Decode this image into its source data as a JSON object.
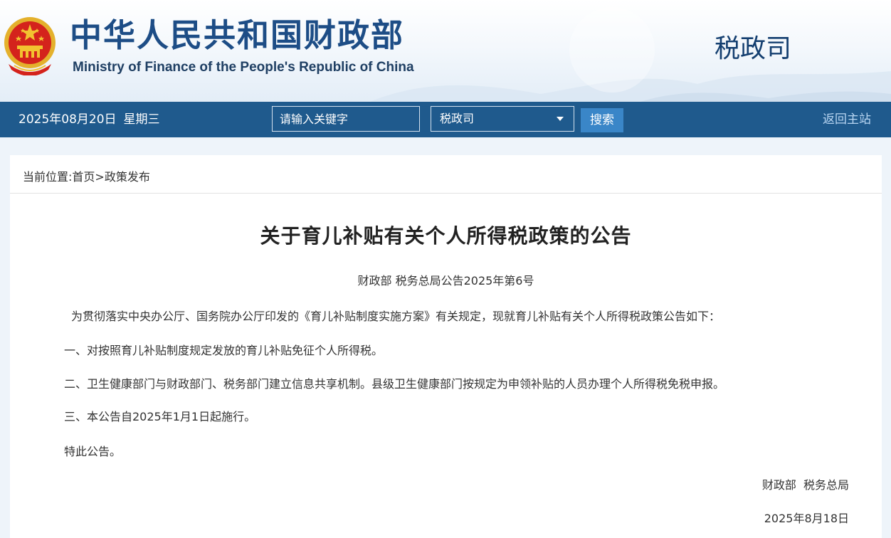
{
  "header": {
    "site_title": "中华人民共和国财政部",
    "site_subtitle": "Ministry of Finance of the People's Republic of China",
    "department": "税政司",
    "emblem_icon": "national-emblem-icon"
  },
  "navbar": {
    "date": "2025年08月20日",
    "weekday": "星期三",
    "search_placeholder": "请输入关键字",
    "scope_selected": "税政司",
    "search_label": "搜索",
    "home_link": "返回主站"
  },
  "breadcrumb": {
    "prefix": "当前位置:",
    "home": "首页",
    "separator": ">",
    "section": "政策发布"
  },
  "article": {
    "title": "关于育儿补贴有关个人所得税政策的公告",
    "doc_number": "财政部 税务总局公告2025年第6号",
    "paragraphs": [
      "为贯彻落实中央办公厅、国务院办公厅印发的《育儿补贴制度实施方案》有关规定，现就育儿补贴有关个人所得税政策公告如下：",
      "一、对按照育儿补贴制度规定发放的育儿补贴免征个人所得税。",
      "二、卫生健康部门与财政部门、税务部门建立信息共享机制。县级卫生健康部门按规定为申领补贴的人员办理个人所得税免税申报。",
      "三、本公告自2025年1月1日起施行。",
      "特此公告。"
    ],
    "issuer": "财政部  税务总局",
    "date": "2025年8月18日"
  },
  "colors": {
    "navbar_bg": "#1f5a8d",
    "title_blue": "#1d4d86",
    "search_button": "#3a86c8",
    "emblem_red": "#d4231c",
    "emblem_gold": "#f2c230"
  }
}
